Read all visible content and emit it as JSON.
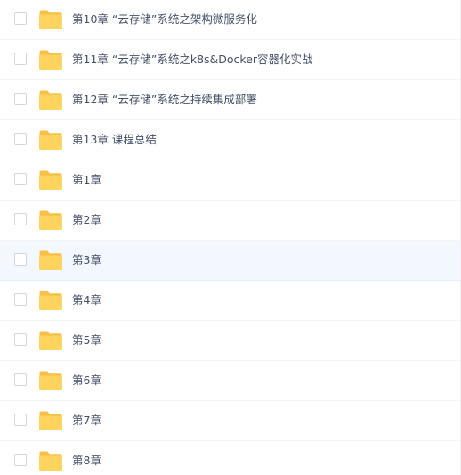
{
  "file_list": {
    "items": [
      {
        "name": "第10章 “云存储”系统之架构微服务化",
        "hover": false
      },
      {
        "name": "第11章 “云存储”系统之k8s&Docker容器化实战",
        "hover": false
      },
      {
        "name": "第12章 “云存储”系统之持续集成部署",
        "hover": false
      },
      {
        "name": "第13章 课程总结",
        "hover": false
      },
      {
        "name": "第1章",
        "hover": false
      },
      {
        "name": "第2章",
        "hover": false
      },
      {
        "name": "第3章",
        "hover": true
      },
      {
        "name": "第4章",
        "hover": false
      },
      {
        "name": "第5章",
        "hover": false
      },
      {
        "name": "第6章",
        "hover": false
      },
      {
        "name": "第7章",
        "hover": false
      },
      {
        "name": "第8章",
        "hover": false
      }
    ]
  },
  "icons": {
    "folder": "folder-icon",
    "checkbox": "checkbox"
  },
  "colors": {
    "folder_body": "#ffd45e",
    "folder_back": "#f8c047",
    "row_hover": "#f2f8fd",
    "text": "#424e67"
  }
}
